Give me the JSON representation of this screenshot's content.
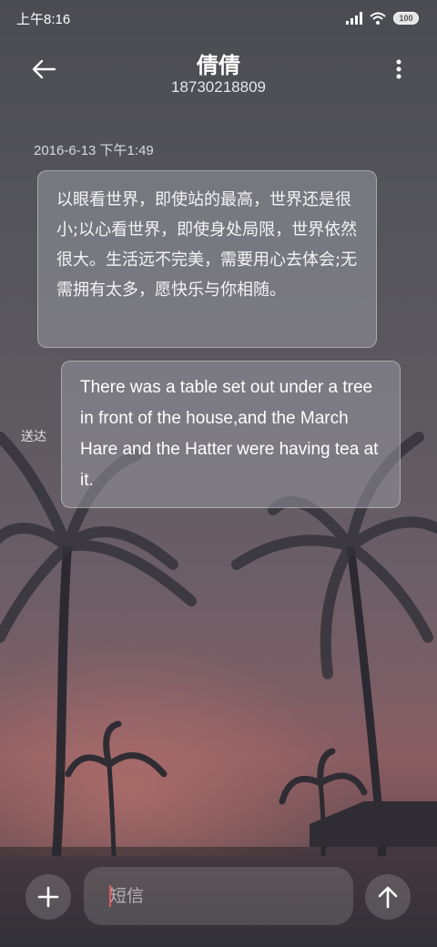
{
  "status_bar": {
    "time": "上午8:16",
    "battery": "100",
    "icons": [
      "vibrate-icon",
      "signal-icon",
      "wifi-icon",
      "battery-icon"
    ]
  },
  "header": {
    "contact_name": "倩倩",
    "phone_number": "18730218809",
    "back_icon": "back-arrow-icon",
    "more_icon": "more-vertical-icon"
  },
  "conversation": {
    "timestamp": "2016-6-13 下午1:49",
    "incoming_message": "以眼看世界，即使站的最高，世界还是很小;以心看世界，即使身处局限，世界依然很大。生活远不完美，需要用心去体会;无需拥有太多，愿快乐与你相随。",
    "outgoing_message": "There was a table set out under a tree in front of the house,and the March Hare and the Hatter were having tea at it.",
    "delivered_status": "送达"
  },
  "composer": {
    "placeholder": "短信",
    "value": "",
    "add_icon": "plus-icon",
    "send_icon": "send-arrow-icon"
  }
}
